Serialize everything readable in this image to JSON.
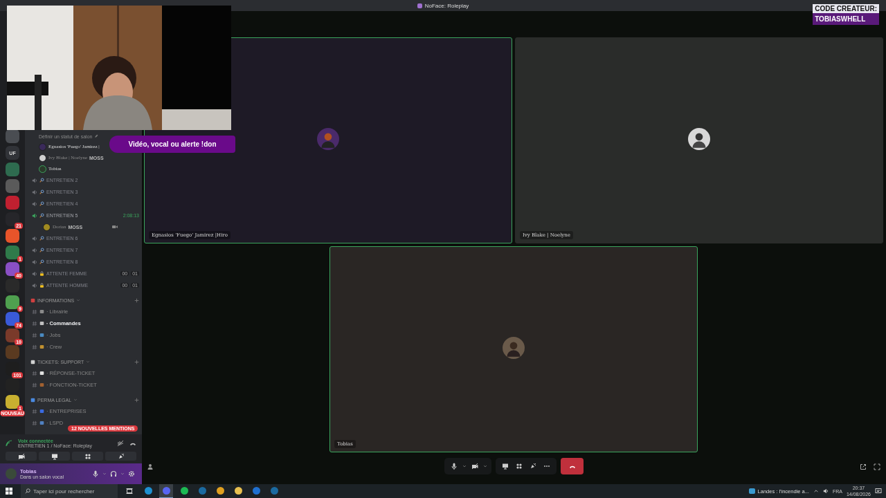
{
  "window": {
    "title": "NoFace: Roleplay"
  },
  "overlay": {
    "alert": "Vidéo, vocal ou alerte !don",
    "badge_line_1": "CODE CREATEUR:",
    "badge_line_2": "TOBIASWHELL"
  },
  "servers": [
    {
      "color": "#4a4d52"
    },
    {
      "color": "#313338",
      "label": "UF"
    },
    {
      "color": "#2e6b4f"
    },
    {
      "color": "#5a5a5a"
    },
    {
      "color": "#c02030"
    },
    {
      "color": "#26262a",
      "badge": "21"
    },
    {
      "color": "#e8542a"
    },
    {
      "color": "#2f7a4a",
      "badge": "1"
    },
    {
      "color": "#8a4fc4",
      "badge": "40"
    },
    {
      "color": "#2a2a2a"
    },
    {
      "color": "#4fa04f",
      "badge": "9"
    },
    {
      "color": "#3a5ad8",
      "badge": "74"
    },
    {
      "color": "#7a3a2a",
      "badge": "10"
    },
    {
      "color": "#5a3a20"
    },
    {
      "color": "#1e1e1e",
      "badge": "101"
    },
    {
      "color": "#222222"
    },
    {
      "color": "#c8b030",
      "badge": "1"
    }
  ],
  "new_server_label": "NOUVEAU",
  "channels": [
    {
      "kind": "hint",
      "name": "Définir un statut de salon"
    },
    {
      "kind": "member",
      "name": "Egnasios 'Fuego' Jamirez |",
      "speaking": false,
      "dimmed": false,
      "color": "#3a2a5a"
    },
    {
      "kind": "member",
      "name": "Ivy Blake | Noelyne",
      "tag": "MOSS",
      "speaking": false,
      "dimmed": true,
      "color": "#d0d0d0"
    },
    {
      "kind": "member",
      "name": "Tobias",
      "speaking": true,
      "dimmed": false,
      "color": "#2a3a2a"
    },
    {
      "kind": "voice",
      "name": "ENTRETIEN 2",
      "active": false,
      "locked": false
    },
    {
      "kind": "voice",
      "name": "ENTRETIEN 3",
      "active": false,
      "locked": false
    },
    {
      "kind": "voice",
      "name": "ENTRETIEN 4",
      "active": false,
      "locked": false
    },
    {
      "kind": "voice",
      "name": "ENTRETIEN 5",
      "active": true,
      "locked": false,
      "timer": "2:08:13"
    },
    {
      "kind": "member",
      "name": "Dorian",
      "tag": "MOSS",
      "speaking": false,
      "dimmed": true,
      "video": true,
      "color": "#a08a20"
    },
    {
      "kind": "voice",
      "name": "ENTRETIEN 6",
      "active": false,
      "locked": false
    },
    {
      "kind": "voice",
      "name": "ENTRETIEN 7",
      "active": false,
      "locked": false
    },
    {
      "kind": "voice",
      "name": "ENTRETIEN 8",
      "active": false,
      "locked": false
    },
    {
      "kind": "voice",
      "name": "ATTENTE FEMME",
      "active": false,
      "locked": true,
      "counts": [
        "00",
        "01"
      ]
    },
    {
      "kind": "voice",
      "name": "ATTENTE HOMME",
      "active": false,
      "locked": true,
      "counts": [
        "00",
        "01"
      ]
    },
    {
      "kind": "category",
      "name": "INFORMATIONS",
      "color": "#d04040"
    },
    {
      "kind": "text",
      "name": "· Librairie",
      "unread": false,
      "color": "#8a8a8a"
    },
    {
      "kind": "text",
      "name": "· Commandes",
      "unread": true,
      "color": "#c0c0c0"
    },
    {
      "kind": "text",
      "name": "· Jobs",
      "unread": false,
      "color": "#4a8ac0"
    },
    {
      "kind": "text",
      "name": "· Crew",
      "unread": false,
      "color": "#c09030"
    },
    {
      "kind": "category",
      "name": "TICKETS: SUPPORT",
      "color": "#d0d0d0"
    },
    {
      "kind": "text",
      "name": "· RÉPONSE-TICKET",
      "unread": false,
      "color": "#e0e0e0"
    },
    {
      "kind": "text",
      "name": "· FONCTION-TICKET",
      "unread": false,
      "color": "#a06030"
    },
    {
      "kind": "category",
      "name": "PERMA LEGAL",
      "color": "#4a8ae0"
    },
    {
      "kind": "text",
      "name": "· ENTREPRISES",
      "unread": false,
      "color": "#3a6ae0"
    },
    {
      "kind": "text",
      "name": "· LSPD",
      "unread": false,
      "color": "#5080c0"
    }
  ],
  "mentions": "12 NOUVELLES MENTIONS",
  "voice_panel": {
    "status": "Voix connectée",
    "channel": "ENTRETIEN 1 / NoFace: Roleplay"
  },
  "user_panel": {
    "name": "Tobias",
    "status": "Dans un salon vocal"
  },
  "tiles": [
    {
      "name": "Egnasios 'Fuego' Jamirez |Hiro",
      "speaking": true,
      "color": "#1e1a26"
    },
    {
      "name": "Ivy Blake | Noelyne",
      "speaking": false,
      "color": "#2a2c2a"
    },
    {
      "name": "Tobias",
      "speaking": true,
      "color": "#2a2624"
    }
  ],
  "taskbar": {
    "search": {
      "placeholder": "Taper ici pour rechercher"
    },
    "apps": [
      {
        "color": "#1e90d0",
        "selected": false
      },
      {
        "color": "#5865f2",
        "selected": true
      },
      {
        "color": "#1db954",
        "selected": false
      },
      {
        "color": "#1b6aa0",
        "selected": false
      },
      {
        "color": "#e0a020",
        "selected": false
      },
      {
        "color": "#e8c050",
        "selected": false
      },
      {
        "color": "#2070d0",
        "selected": false
      },
      {
        "color": "#1b6aa0",
        "selected": false
      }
    ],
    "news": "Landes : l'incendie a...",
    "language": "FRA",
    "time": "20:37",
    "date": "14/08/2026"
  }
}
